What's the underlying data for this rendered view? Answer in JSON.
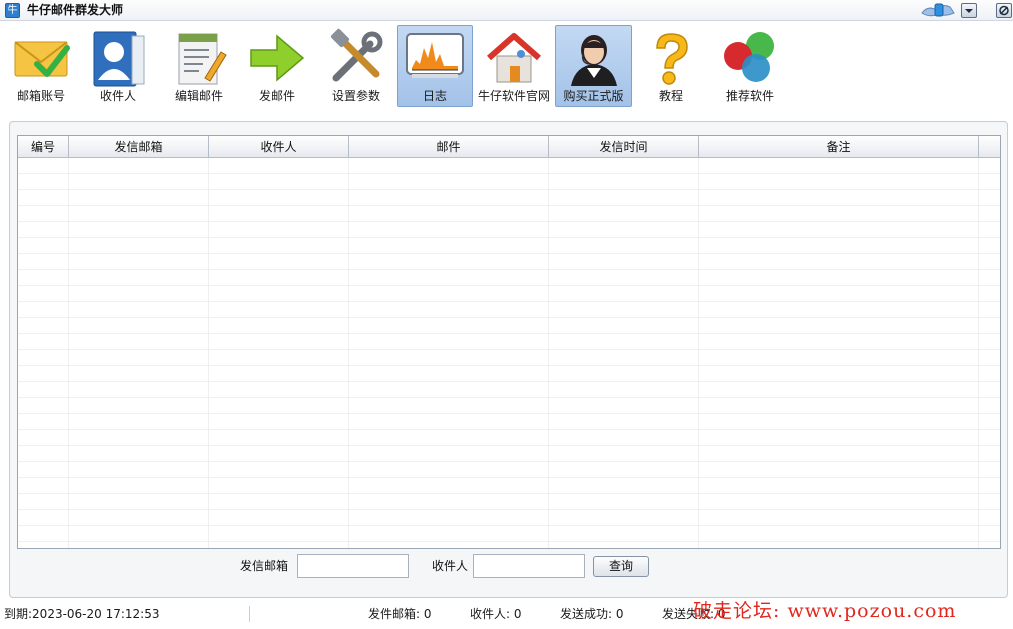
{
  "window": {
    "app_icon_glyph": "牛",
    "title": "牛仔邮件群发大师"
  },
  "toolbar": {
    "items": [
      {
        "label": "邮箱账号",
        "icon": "envelope-icon"
      },
      {
        "label": "收件人",
        "icon": "contacts-icon"
      },
      {
        "label": "编辑邮件",
        "icon": "document-pencil-icon"
      },
      {
        "label": "发邮件",
        "icon": "green-arrow-icon"
      },
      {
        "label": "设置参数",
        "icon": "tools-icon"
      },
      {
        "label": "日志",
        "icon": "chart-icon",
        "active": true
      },
      {
        "label": "牛仔软件官网",
        "icon": "home-icon"
      },
      {
        "label": "购买正式版",
        "icon": "support-agent-icon",
        "active": true
      },
      {
        "label": "教程",
        "icon": "question-icon"
      },
      {
        "label": "推荐软件",
        "icon": "color-balls-icon"
      }
    ]
  },
  "table": {
    "columns": [
      "编号",
      "发信邮箱",
      "收件人",
      "邮件",
      "发信时间",
      "备注"
    ],
    "rows": []
  },
  "search": {
    "sender_label": "发信邮箱",
    "sender_value": "",
    "recipient_label": "收件人",
    "recipient_value": "",
    "query_button": "查询"
  },
  "status": {
    "expiry": "到期:2023-06-20 17:12:53",
    "sender_count": "发件邮箱: 0",
    "recipient_count": "收件人: 0",
    "success_count": "发送成功: 0",
    "fail_count": "发送失败: 0"
  },
  "watermark": "破走论坛: www.pozou.com",
  "colors": {
    "active_tool": "#a3c2e8",
    "watermark": "#e0271d",
    "grid_border": "#9aa6b4"
  }
}
